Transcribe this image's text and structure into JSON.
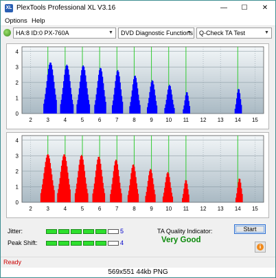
{
  "window": {
    "title": "PlexTools Professional XL V3.16",
    "icon_name": "plextools-app-icon",
    "controls": {
      "minimize": "—",
      "maximize": "☐",
      "close": "✕"
    }
  },
  "menu": {
    "items": [
      {
        "label": "Options"
      },
      {
        "label": "Help"
      }
    ]
  },
  "toolbar": {
    "drive": "HA:8 ID:0  PX-760A",
    "function": "DVD Diagnostic Functions",
    "test": "Q-Check TA Test"
  },
  "colors": {
    "top_series": "#0000ff",
    "bottom_series": "#ff0000",
    "peak_marker": "#33cc33",
    "plot_bg_top": "#f2f6f8",
    "plot_bg_bottom": "#a9b9c3",
    "indicator_good": "#0c8a0c",
    "status_text": "#cc0000"
  },
  "chart_data": [
    {
      "type": "bar",
      "name": "ta-top",
      "x_ticks": [
        "2",
        "3",
        "4",
        "5",
        "6",
        "7",
        "8",
        "9",
        "10",
        "11",
        "12",
        "13",
        "14",
        "15"
      ],
      "y_ticks": [
        "0",
        "1",
        "2",
        "3",
        "4"
      ],
      "xlim": [
        1.5,
        15.5
      ],
      "ylim": [
        0,
        4.3
      ],
      "grid": true,
      "peak_markers": [
        3.0,
        4.0,
        5.0,
        6.0,
        7.0,
        8.0,
        9.0,
        10.0,
        11.0,
        14.0
      ],
      "color": "#0000ff",
      "peaks": [
        {
          "center": 3.15,
          "height": 3.3,
          "width": 0.38
        },
        {
          "center": 4.1,
          "height": 3.15,
          "width": 0.36
        },
        {
          "center": 5.05,
          "height": 3.1,
          "width": 0.36
        },
        {
          "center": 6.05,
          "height": 2.95,
          "width": 0.33
        },
        {
          "center": 7.05,
          "height": 2.8,
          "width": 0.31
        },
        {
          "center": 8.05,
          "height": 2.45,
          "width": 0.3
        },
        {
          "center": 9.05,
          "height": 2.15,
          "width": 0.28
        },
        {
          "center": 10.05,
          "height": 1.85,
          "width": 0.27
        },
        {
          "center": 11.05,
          "height": 1.4,
          "width": 0.2
        },
        {
          "center": 14.05,
          "height": 1.6,
          "width": 0.2
        }
      ]
    },
    {
      "type": "bar",
      "name": "ta-bottom",
      "x_ticks": [
        "2",
        "3",
        "4",
        "5",
        "6",
        "7",
        "8",
        "9",
        "10",
        "11",
        "12",
        "13",
        "14",
        "15"
      ],
      "y_ticks": [
        "0",
        "1",
        "2",
        "3",
        "4"
      ],
      "xlim": [
        1.5,
        15.5
      ],
      "ylim": [
        0,
        4.3
      ],
      "grid": true,
      "peak_markers": [
        3.0,
        4.0,
        5.0,
        6.0,
        7.0,
        8.0,
        9.0,
        10.0,
        11.0,
        14.0
      ],
      "color": "#ff0000",
      "peaks": [
        {
          "center": 3.0,
          "height": 3.1,
          "width": 0.4
        },
        {
          "center": 3.95,
          "height": 3.1,
          "width": 0.38
        },
        {
          "center": 4.95,
          "height": 3.05,
          "width": 0.36
        },
        {
          "center": 5.95,
          "height": 2.95,
          "width": 0.34
        },
        {
          "center": 6.95,
          "height": 2.75,
          "width": 0.32
        },
        {
          "center": 7.95,
          "height": 2.45,
          "width": 0.3
        },
        {
          "center": 8.95,
          "height": 2.15,
          "width": 0.28
        },
        {
          "center": 9.95,
          "height": 1.95,
          "width": 0.27
        },
        {
          "center": 11.0,
          "height": 1.45,
          "width": 0.2
        },
        {
          "center": 14.1,
          "height": 1.55,
          "width": 0.2
        }
      ]
    }
  ],
  "metrics": {
    "jitter": {
      "label": "Jitter:",
      "value": "5",
      "segments_on": 5,
      "segments_total": 6
    },
    "peak_shift": {
      "label": "Peak Shift:",
      "value": "4",
      "segments_on": 5,
      "segments_total": 6
    }
  },
  "ta_quality": {
    "label": "TA Quality Indicator:",
    "value": "Very Good"
  },
  "buttons": {
    "start": "Start",
    "info_icon": "info-icon"
  },
  "status": {
    "text": "Ready"
  },
  "caption": {
    "text": "569x551  44kb  PNG"
  }
}
